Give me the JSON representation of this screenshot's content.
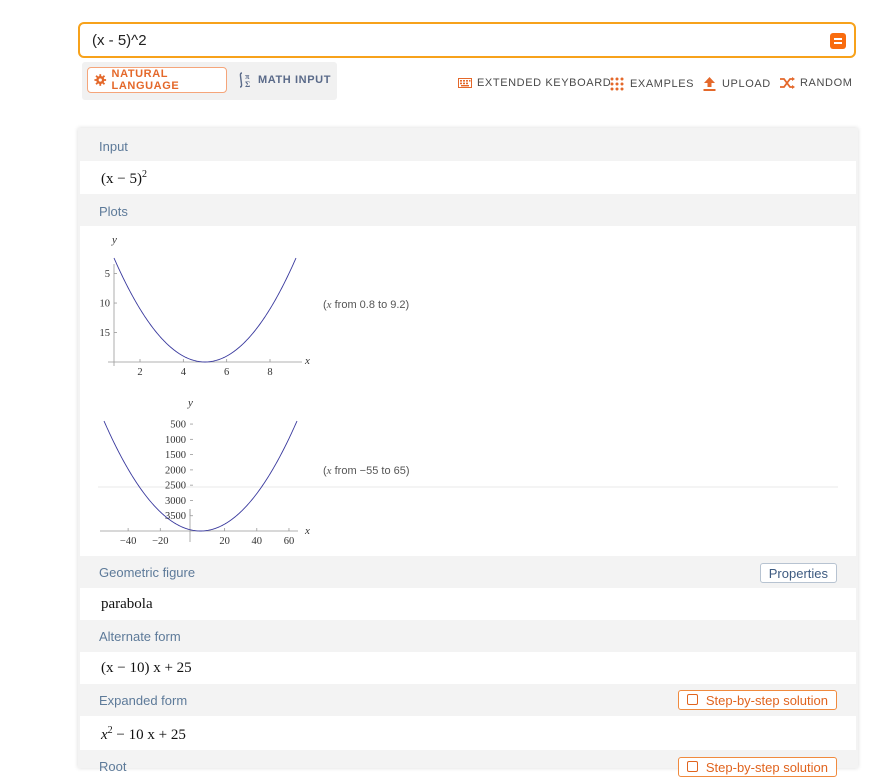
{
  "search": {
    "query": "(x - 5)^2"
  },
  "modes": {
    "natural": "NATURAL LANGUAGE",
    "math": "MATH INPUT"
  },
  "tools": {
    "keyboard": "EXTENDED KEYBOARD",
    "examples": "EXAMPLES",
    "upload": "UPLOAD",
    "random": "RANDOM"
  },
  "colors": {
    "accent": "#f96c0e",
    "pod_title": "#5d7a99",
    "curve": "#3a3a9e"
  },
  "pods": {
    "input": {
      "title": "Input",
      "expr": "(x − 5)",
      "exp": "2"
    },
    "plots": {
      "title": "Plots",
      "plot1": {
        "ylabel": "y",
        "xlabel": "x",
        "xticks": [
          "2",
          "4",
          "6",
          "8"
        ],
        "yticks": [
          "15",
          "10",
          "5"
        ],
        "range_pre": "(",
        "range_var": "x",
        "range_text": " from 0.8 to 9.2)"
      },
      "plot2": {
        "ylabel": "y",
        "xlabel": "x",
        "xticks": [
          "−40",
          "−20",
          "20",
          "40",
          "60"
        ],
        "yticks": [
          "3500",
          "3000",
          "2500",
          "2000",
          "1500",
          "1000",
          "500"
        ],
        "range_pre": "(",
        "range_var": "x",
        "range_text": " from −55 to 65)"
      }
    },
    "geometric": {
      "title": "Geometric figure",
      "button": "Properties",
      "value": "parabola"
    },
    "alternate": {
      "title": "Alternate form",
      "value": "(x − 10) x + 25"
    },
    "expanded": {
      "title": "Expanded form",
      "button": "Step-by-step solution",
      "x": "x",
      "exp": "2",
      "rest": " − 10 x + 25"
    },
    "root": {
      "title": "Root",
      "button": "Step-by-step solution"
    }
  },
  "chart_data": [
    {
      "type": "line",
      "function": "(x - 5)^2",
      "xlim": [
        0.8,
        9.2
      ],
      "ylim": [
        0,
        17.64
      ],
      "xticks": [
        2,
        4,
        6,
        8
      ],
      "yticks": [
        5,
        10,
        15
      ],
      "xlabel": "x",
      "ylabel": "y"
    },
    {
      "type": "line",
      "function": "(x - 5)^2",
      "xlim": [
        -55,
        65
      ],
      "ylim": [
        0,
        3600
      ],
      "xticks": [
        -40,
        -20,
        20,
        40,
        60
      ],
      "yticks": [
        500,
        1000,
        1500,
        2000,
        2500,
        3000,
        3500
      ],
      "xlabel": "x",
      "ylabel": "y"
    }
  ]
}
